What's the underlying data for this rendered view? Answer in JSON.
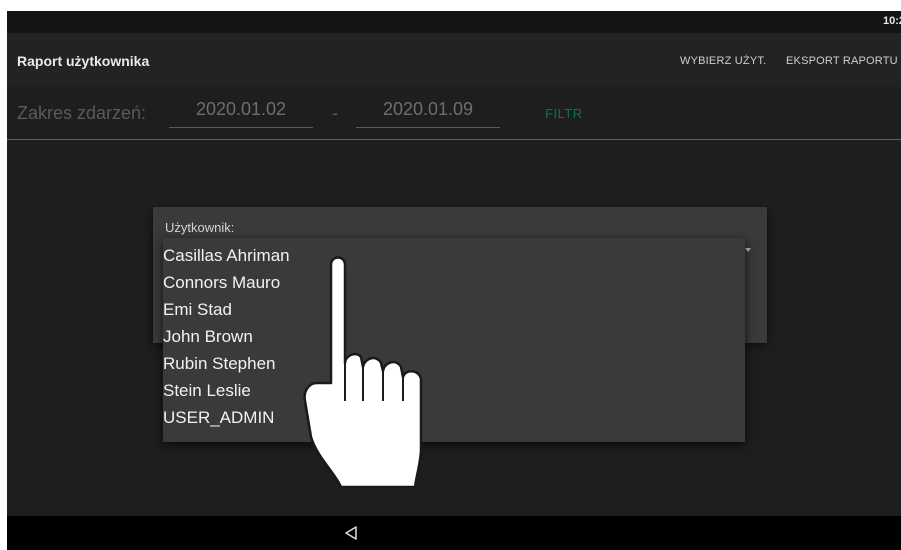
{
  "status_bar": {
    "time": "10:2"
  },
  "app_bar": {
    "title": "Raport użytkownika",
    "actions": [
      {
        "label": "WYBIERZ UŻYT."
      },
      {
        "label": "EKSPORT RAPORTU"
      }
    ]
  },
  "range": {
    "label": "Zakres zdarzeń:",
    "from": "2020.01.02",
    "separator": "-",
    "to": "2020.01.09",
    "filter_label": "FILTR"
  },
  "dialog": {
    "label": "Użytkownik:",
    "options": [
      "Casillas Ahriman",
      "Connors Mauro",
      "Emi Stad",
      "John Brown",
      "Rubin Stephen",
      "Stein Leslie",
      "USER_ADMIN"
    ]
  },
  "nav_bar": {
    "back_icon": "back-triangle-icon"
  },
  "overlay": {
    "hand_icon": "pointing-hand-icon"
  },
  "colors": {
    "background": "#1e1e1e",
    "app_bar": "#232323",
    "accent": "#12806f",
    "dialog": "#3a3a3a"
  }
}
